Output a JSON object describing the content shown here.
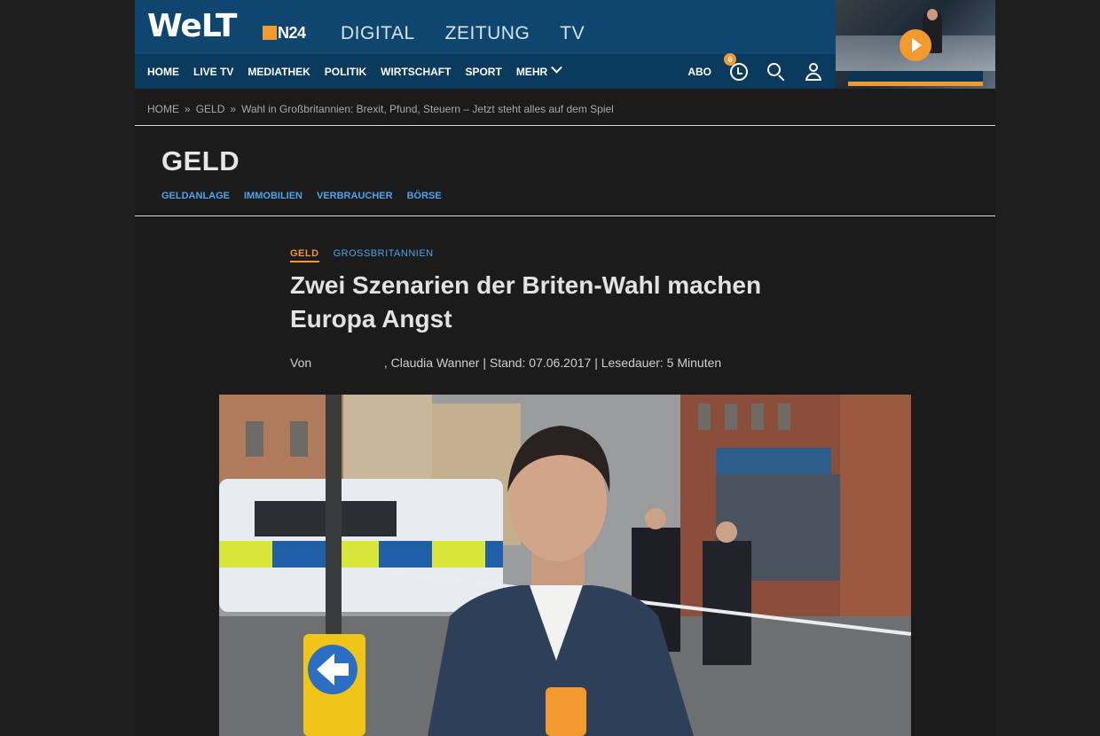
{
  "header": {
    "logo": "WeLT",
    "n24": "N24",
    "sections": [
      "DIGITAL",
      "ZEITUNG",
      "TV"
    ],
    "nav": [
      "HOME",
      "LIVE TV",
      "MEDIATHEK",
      "POLITIK",
      "WIRTSCHAFT",
      "SPORT",
      "MEHR"
    ],
    "abo": "ABO",
    "notification_count": "6"
  },
  "breadcrumb": [
    "HOME",
    "GELD",
    "Wahl in Großbritannien: Brexit, Pfund, Steuern – Jetzt steht alles auf dem Spiel"
  ],
  "breadcrumb_sep": "»",
  "section": {
    "title": "GELD",
    "subnav": [
      "GELDANLAGE",
      "IMMOBILIEN",
      "VERBRAUCHER",
      "BÖRSE"
    ]
  },
  "article": {
    "tag_primary": "GELD",
    "tag_secondary": "GROSSBRITANNIEN",
    "headline": "Zwei Szenarien der Briten-Wahl machen Europa Angst",
    "byline": "Von                     , Claudia Wanner | Stand: 07.06.2017 | Lesedauer: 5 Minuten"
  },
  "colors": {
    "accent": "#f29a2e",
    "link": "#4ca3e8",
    "header_bg": "#0e4670"
  }
}
